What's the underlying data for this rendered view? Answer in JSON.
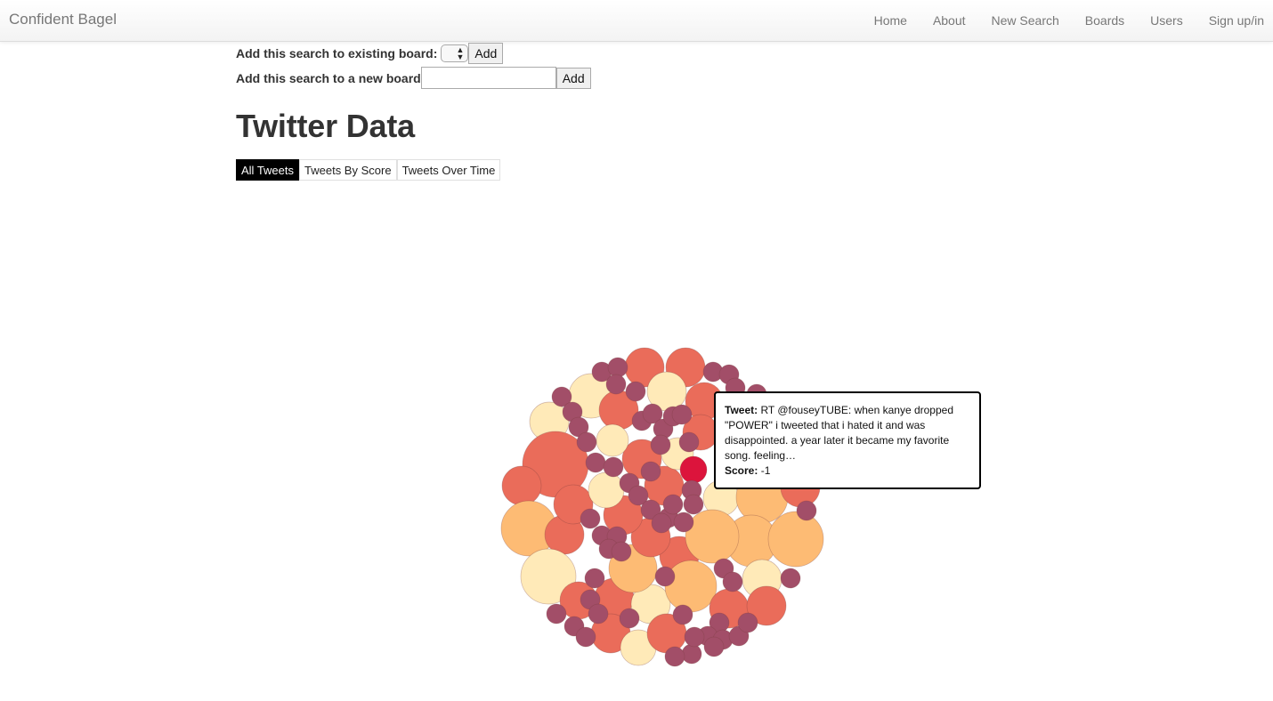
{
  "nav": {
    "brand": "Confident Bagel",
    "links": [
      "Home",
      "About",
      "New Search",
      "Boards",
      "Users",
      "Sign up/in"
    ]
  },
  "board_form": {
    "existing_label": "Add this search to existing board:",
    "existing_selected": "",
    "existing_add": "Add",
    "new_label": "Add this search to a new board",
    "new_value": "",
    "new_add": "Add"
  },
  "page_title": "Twitter Data",
  "tabs": [
    "All Tweets",
    "Tweets By Score",
    "Tweets Over Time"
  ],
  "active_tab": "All Tweets",
  "colors": {
    "score_neg_strong": "#dc143c",
    "score_neg": "#ea6c5a",
    "score_mid": "#fdbb74",
    "score_light": "#ffeab8",
    "small": "#a24e68"
  },
  "tooltip": {
    "tweet_label": "Tweet:",
    "tweet_text": "RT @fouseyTUBE: when kanye dropped \"POWER\" i tweeted that i hated it and was disappointed. a year later it became my favorite song. feeling…",
    "score_label": "Score:",
    "score_value": "-1"
  }
}
